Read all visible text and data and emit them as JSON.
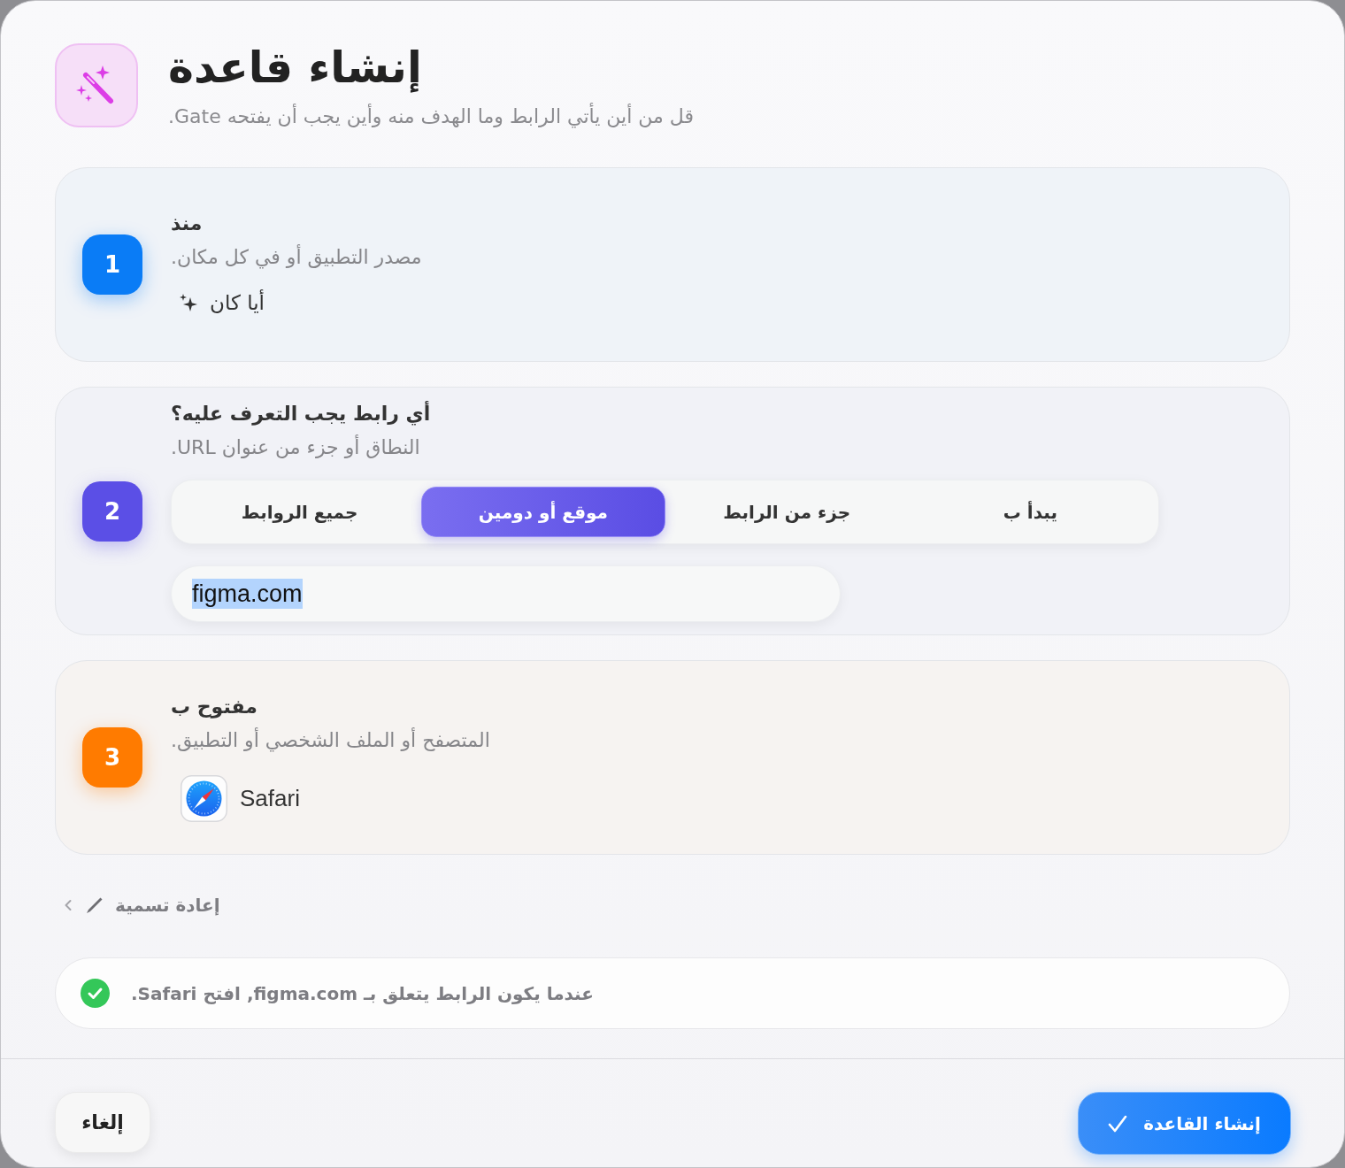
{
  "header": {
    "title": "إنشاء قاعدة",
    "subtitle": "قل من أين يأتي الرابط وما الهدف منه وأين يجب أن يفتحه Gate."
  },
  "steps": [
    {
      "kind": "option",
      "number": "1",
      "color": "#0a7cf6",
      "title": "منذ",
      "description": "مصدر التطبيق أو في كل مكان.",
      "option": {
        "label": "أيا كان"
      }
    },
    {
      "kind": "matcher",
      "number": "2",
      "color": "#5b4fe6",
      "title": "أي رابط يجب التعرف عليه؟",
      "description": "النطاق أو جزء من عنوان URL.",
      "segments": [
        {
          "label": "يبدأ ب",
          "selected": false
        },
        {
          "label": "جزء من الرابط",
          "selected": false
        },
        {
          "label": "موقع أو دومين",
          "selected": true
        },
        {
          "label": "جميع الروابط",
          "selected": false
        }
      ],
      "input": {
        "value": "figma.com",
        "value_selected": true
      }
    },
    {
      "kind": "app",
      "number": "3",
      "color": "#ff7b00",
      "title": "مفتوح ب",
      "description": "المتصفح أو الملف الشخصي أو التطبيق.",
      "app": {
        "name": "Safari"
      }
    }
  ],
  "rename": {
    "label": "إعادة تسمية",
    "expanded": false
  },
  "summary": {
    "text": "عندما يكون الرابط يتعلق بـ figma.com, افتح Safari.",
    "valid": true
  },
  "footer": {
    "cancel": "إلغاء",
    "submit": "إنشاء القاعدة"
  }
}
